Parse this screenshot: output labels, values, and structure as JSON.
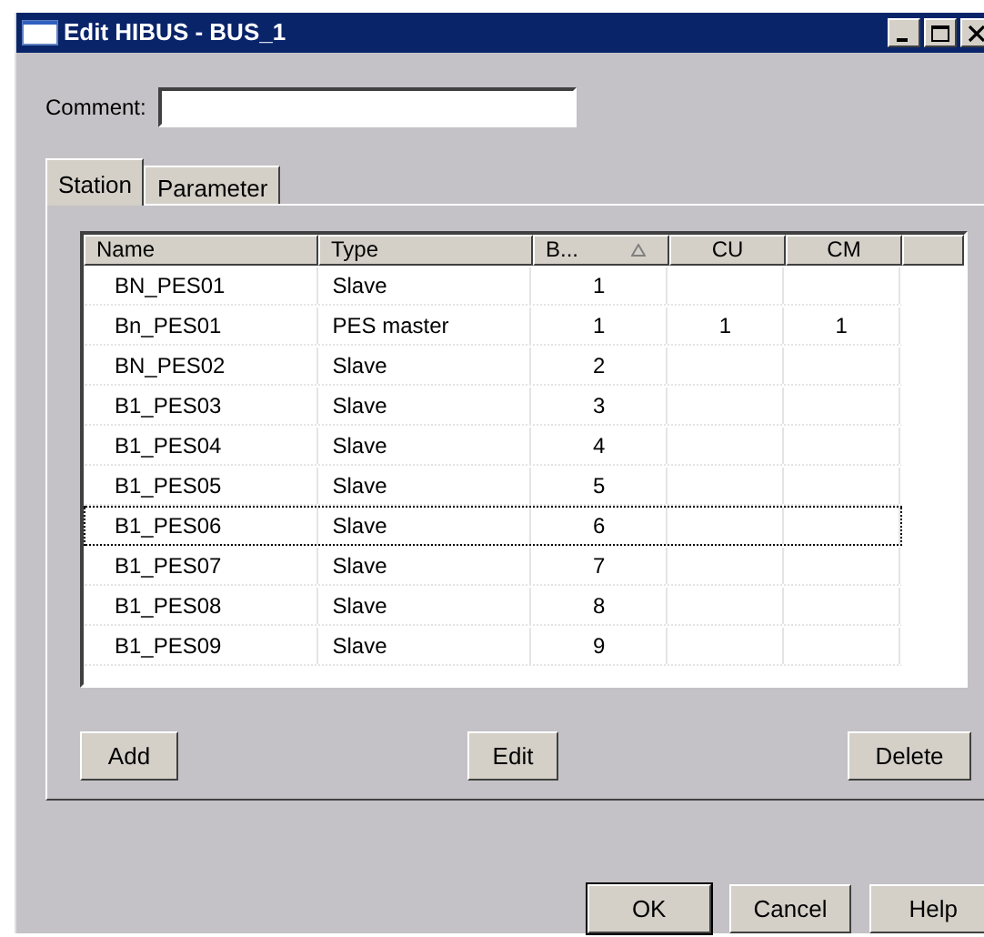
{
  "window": {
    "title": "Edit HIBUS - BUS_1"
  },
  "comment": {
    "label": "Comment:"
  },
  "tabs": [
    {
      "label": "Station",
      "selected": true
    },
    {
      "label": "Parameter",
      "selected": false
    }
  ],
  "table": {
    "columns": [
      {
        "label": "Name",
        "sorted": false
      },
      {
        "label": "Type",
        "sorted": false
      },
      {
        "label": "B...",
        "sorted": true
      },
      {
        "label": "CU",
        "sorted": false
      },
      {
        "label": "CM",
        "sorted": false
      }
    ],
    "rows": [
      {
        "cells": [
          "BN_PES01",
          "Slave",
          "1",
          "",
          ""
        ],
        "focused": false
      },
      {
        "cells": [
          "Bn_PES01",
          "PES master",
          "1",
          "1",
          "1"
        ],
        "focused": false
      },
      {
        "cells": [
          "BN_PES02",
          "Slave",
          "2",
          "",
          ""
        ],
        "focused": false
      },
      {
        "cells": [
          "B1_PES03",
          "Slave",
          "3",
          "",
          ""
        ],
        "focused": false
      },
      {
        "cells": [
          "B1_PES04",
          "Slave",
          "4",
          "",
          ""
        ],
        "focused": false
      },
      {
        "cells": [
          "B1_PES05",
          "Slave",
          "5",
          "",
          ""
        ],
        "focused": false
      },
      {
        "cells": [
          "B1_PES06",
          "Slave",
          "6",
          "",
          ""
        ],
        "focused": true
      },
      {
        "cells": [
          "B1_PES07",
          "Slave",
          "7",
          "",
          ""
        ],
        "focused": false
      },
      {
        "cells": [
          "B1_PES08",
          "Slave",
          "8",
          "",
          ""
        ],
        "focused": false
      },
      {
        "cells": [
          "B1_PES09",
          "Slave",
          "9",
          "",
          ""
        ],
        "focused": false
      }
    ]
  },
  "list_buttons": [
    "Add",
    "Edit",
    "Delete"
  ],
  "dialog_buttons": [
    {
      "label": "OK",
      "default": true
    },
    {
      "label": "Cancel",
      "default": false
    },
    {
      "label": "Help",
      "default": false
    }
  ]
}
